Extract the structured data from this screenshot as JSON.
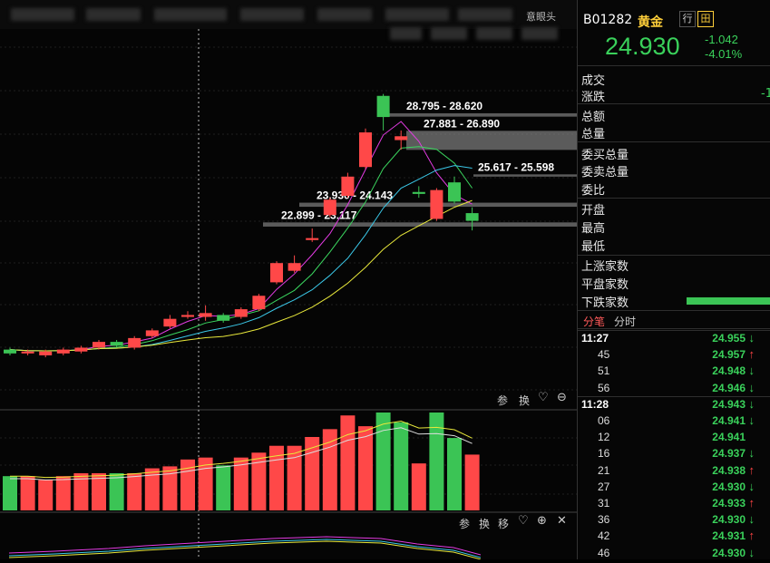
{
  "topbar": {
    "label": "意眼头"
  },
  "quote": {
    "code": "B01282",
    "name": "黄金",
    "tag1": "行",
    "tag2": "田",
    "price": "24.930",
    "change": "-1.042",
    "change_pct": "-4.01%"
  },
  "fields": {
    "volume": "成交",
    "change": "涨跌",
    "change_value": "-1",
    "amount": "总额",
    "total": "总量",
    "bid_total": "委买总量",
    "ask_total": "委卖总量",
    "ratio": "委比",
    "open": "开盘",
    "high": "最高",
    "low": "最低",
    "up_count": "上涨家数",
    "flat_count": "平盘家数",
    "down_count": "下跌家数"
  },
  "tabs": {
    "ticks": "分笔",
    "minute": "分时"
  },
  "ticks": [
    {
      "time": "11:27",
      "bold": true,
      "price": "24.955",
      "dir": "down"
    },
    {
      "time": "45",
      "bold": false,
      "price": "24.957",
      "dir": "up"
    },
    {
      "time": "51",
      "bold": false,
      "price": "24.948",
      "dir": "down"
    },
    {
      "time": "56",
      "bold": false,
      "price": "24.946",
      "dir": "down"
    },
    {
      "time": "11:28",
      "bold": true,
      "price": "24.943",
      "dir": "down"
    },
    {
      "time": "06",
      "bold": false,
      "price": "24.941",
      "dir": "down"
    },
    {
      "time": "12",
      "bold": false,
      "price": "24.941",
      "dir": ""
    },
    {
      "time": "16",
      "bold": false,
      "price": "24.937",
      "dir": "down"
    },
    {
      "time": "21",
      "bold": false,
      "price": "24.938",
      "dir": "up"
    },
    {
      "time": "27",
      "bold": false,
      "price": "24.930",
      "dir": "down"
    },
    {
      "time": "31",
      "bold": false,
      "price": "24.933",
      "dir": "up"
    },
    {
      "time": "36",
      "bold": false,
      "price": "24.930",
      "dir": "down"
    },
    {
      "time": "42",
      "bold": false,
      "price": "24.931",
      "dir": "up"
    },
    {
      "time": "46",
      "bold": false,
      "price": "24.930",
      "dir": "down"
    }
  ],
  "chart_data": {
    "type": "candlestick",
    "candles": [
      {
        "o": 16.3,
        "c": 16.5,
        "h": 16.6,
        "l": 16.2,
        "up": false
      },
      {
        "o": 16.3,
        "c": 16.4,
        "h": 16.5,
        "l": 16.2,
        "up": true
      },
      {
        "o": 16.2,
        "c": 16.4,
        "h": 16.5,
        "l": 16.1,
        "up": true
      },
      {
        "o": 16.3,
        "c": 16.5,
        "h": 16.6,
        "l": 16.2,
        "up": true
      },
      {
        "o": 16.4,
        "c": 16.6,
        "h": 16.7,
        "l": 16.3,
        "up": true
      },
      {
        "o": 16.6,
        "c": 16.9,
        "h": 17.0,
        "l": 16.5,
        "up": true
      },
      {
        "o": 16.9,
        "c": 16.7,
        "h": 17.0,
        "l": 16.6,
        "up": false
      },
      {
        "o": 16.6,
        "c": 17.1,
        "h": 17.2,
        "l": 16.5,
        "up": true
      },
      {
        "o": 17.2,
        "c": 17.5,
        "h": 17.6,
        "l": 17.1,
        "up": true
      },
      {
        "o": 17.7,
        "c": 18.1,
        "h": 18.3,
        "l": 17.6,
        "up": true
      },
      {
        "o": 18.2,
        "c": 18.3,
        "h": 18.5,
        "l": 18.1,
        "up": true
      },
      {
        "o": 18.2,
        "c": 18.4,
        "h": 18.8,
        "l": 18.0,
        "up": true
      },
      {
        "o": 18.3,
        "c": 18.0,
        "h": 18.4,
        "l": 17.9,
        "up": false
      },
      {
        "o": 18.2,
        "c": 18.6,
        "h": 18.7,
        "l": 18.1,
        "up": true
      },
      {
        "o": 18.6,
        "c": 19.3,
        "h": 19.4,
        "l": 18.5,
        "up": true
      },
      {
        "o": 20.0,
        "c": 21.0,
        "h": 21.1,
        "l": 19.9,
        "up": true
      },
      {
        "o": 20.6,
        "c": 21.0,
        "h": 21.4,
        "l": 20.5,
        "up": true
      },
      {
        "o": 22.2,
        "c": 22.3,
        "h": 22.8,
        "l": 22.1,
        "up": true
      },
      {
        "o": 23.5,
        "c": 24.3,
        "h": 24.4,
        "l": 23.4,
        "up": true
      },
      {
        "o": 24.5,
        "c": 25.5,
        "h": 25.7,
        "l": 24.4,
        "up": true
      },
      {
        "o": 26.0,
        "c": 27.8,
        "h": 28.0,
        "l": 25.9,
        "up": true
      },
      {
        "o": 28.6,
        "c": 29.7,
        "h": 29.8,
        "l": 27.9,
        "up": false
      },
      {
        "o": 27.4,
        "c": 27.6,
        "h": 27.9,
        "l": 26.9,
        "up": true
      },
      {
        "o": 24.6,
        "c": 24.7,
        "h": 25.0,
        "l": 24.4,
        "up": false
      },
      {
        "o": 23.3,
        "c": 24.8,
        "h": 24.9,
        "l": 23.2,
        "up": true
      },
      {
        "o": 25.2,
        "c": 24.2,
        "h": 25.5,
        "l": 24.1,
        "up": false
      },
      {
        "o": 23.6,
        "c": 23.2,
        "h": 23.9,
        "l": 22.7,
        "up": false
      }
    ],
    "levels": [
      {
        "text": "28.795 - 28.620",
        "upper": 28.795,
        "lower": 28.62
      },
      {
        "text": "27.881 - 26.890",
        "upper": 27.881,
        "lower": 26.89
      },
      {
        "text": "25.617 - 25.598",
        "upper": 25.617,
        "lower": 25.598
      },
      {
        "text": "23.930 - 24.143",
        "upper": 24.143,
        "lower": 23.93
      },
      {
        "text": "22.899 - 23.117",
        "upper": 23.117,
        "lower": 22.899
      }
    ],
    "volume_up": [
      false,
      true,
      true,
      true,
      true,
      true,
      false,
      true,
      true,
      true,
      true,
      true,
      false,
      true,
      true,
      true,
      true,
      true,
      true,
      true,
      true,
      false,
      false,
      true,
      false,
      false
    ],
    "volume_values": [
      0.35,
      0.35,
      0.31,
      0.35,
      0.38,
      0.38,
      0.38,
      0.38,
      0.43,
      0.45,
      0.52,
      0.54,
      0.46,
      0.54,
      0.59,
      0.66,
      0.66,
      0.75,
      0.83,
      0.97,
      0.86,
      1.0,
      0.9,
      0.48,
      1.0,
      0.74,
      0.57
    ]
  },
  "pane_buttons": {
    "p1": "参",
    "p2": "换",
    "p3": "参",
    "p4": "换",
    "p5": "移"
  },
  "colors": {
    "up": "#ff4848",
    "down": "#3bc455",
    "price": "#3ad15b"
  }
}
